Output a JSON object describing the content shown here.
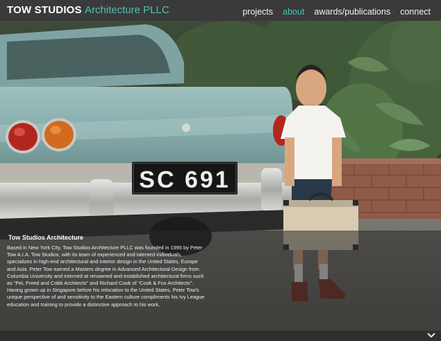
{
  "header": {
    "brand_bold": "TOW STUDIOS",
    "brand_light": "Architecture PLLC",
    "nav": [
      {
        "label": "projects",
        "active": false
      },
      {
        "label": "about",
        "active": true
      },
      {
        "label": "awards/publications",
        "active": false
      },
      {
        "label": "connect",
        "active": false
      }
    ]
  },
  "hero": {
    "plate_text": "SC 691"
  },
  "caption": {
    "title": "Tow Studios Architecture",
    "body": "Based in New York City, Tow Studios Architecture PLLC was founded in 1995 by Peter Tow A.I.A. Tow Studios, with its team of experienced and talented individuals, specializes in high-end architectural and interior design in the United States, Europe and Asia. Peter Tow earned a Masters degree in Advanced Architectural Design from Columbia University and interned at renowned and established architectural firms such as “Pei, Freed and Cobb Architects” and Richard Cook of “Cook & Fox Architects”. Having grown up in Singapore before his relocation to the United States, Peter Tow’s unique perspective of and sensitivity to the Eastern culture compliments his Ivy League education and training to provide a distinctive approach to his work."
  },
  "footer": {
    "scroll_icon": "chevron-down-icon"
  },
  "colors": {
    "accent": "#4cc3b3",
    "header_bg": "#3a3a3a",
    "car": "#8fb4b3"
  }
}
